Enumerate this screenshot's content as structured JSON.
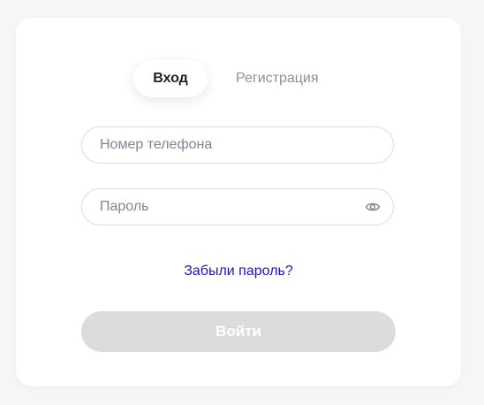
{
  "tabs": {
    "login_label": "Вход",
    "register_label": "Регистрация",
    "active": "login"
  },
  "form": {
    "phone_placeholder": "Номер телефона",
    "phone_value": "",
    "password_placeholder": "Пароль",
    "password_value": "",
    "password_toggle_icon": "eye-icon",
    "forgot_label": "Забыли пароль?",
    "submit_label": "Войти",
    "submit_enabled": false
  },
  "colors": {
    "page_background": "#f5f6f8",
    "card_background": "#ffffff",
    "link": "#2210c9",
    "button_disabled": "#dcdcdc",
    "placeholder_text": "#7e8494",
    "inactive_tab_text": "#8a90a0",
    "active_tab_text": "#1b1f2a"
  }
}
